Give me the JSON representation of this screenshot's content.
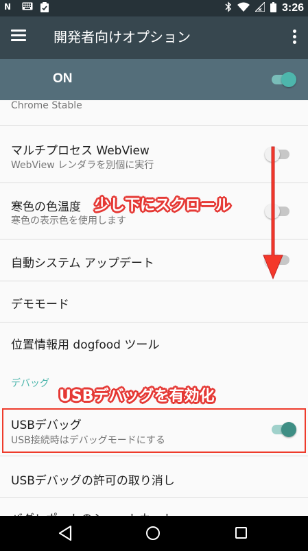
{
  "status_bar": {
    "left_icons": [
      "n-icon",
      "keyboard-icon",
      "clipboard-icon"
    ],
    "right_icons": [
      "bluetooth-icon",
      "wifi-icon",
      "signal-icon",
      "battery-icon"
    ],
    "time": "3:26"
  },
  "app_bar": {
    "title": "開発者向けオプション"
  },
  "master_switch": {
    "label": "ON",
    "state": "on"
  },
  "settings": {
    "chrome_stable": "Chrome Stable",
    "multiprocess": {
      "title": "マルチプロセス WebView",
      "summary": "WebView レンダラを別個に実行",
      "state": "off"
    },
    "color_temp": {
      "title": "寒色の色温度",
      "summary": "寒色の表示色を使用します",
      "state": "off"
    },
    "auto_update": {
      "title": "自動システム アップデート",
      "state": "off"
    },
    "demo_mode": {
      "title": "デモモード"
    },
    "dogfood": {
      "title": "位置情報用 dogfood ツール"
    },
    "debug_category": "デバッグ",
    "usb_debug": {
      "title": "USBデバッグ",
      "summary": "USB接続時はデバッグモードにする",
      "state": "on"
    },
    "revoke_usb": {
      "title": "USBデバッグの許可の取り消し"
    },
    "partial_next": "バグレポートのショートカット"
  },
  "annotations": {
    "scroll_hint": "少し下にスクロール",
    "enable_usb": "USBデバッグを有効化"
  },
  "colors": {
    "status_bar": "#263238",
    "app_bar": "#37474f",
    "master_bar": "#546e7a",
    "accent": "#4db6ac",
    "annotation": "#e53935"
  },
  "nav_bar": {
    "buttons": [
      "back-icon",
      "home-icon",
      "recents-icon"
    ]
  }
}
